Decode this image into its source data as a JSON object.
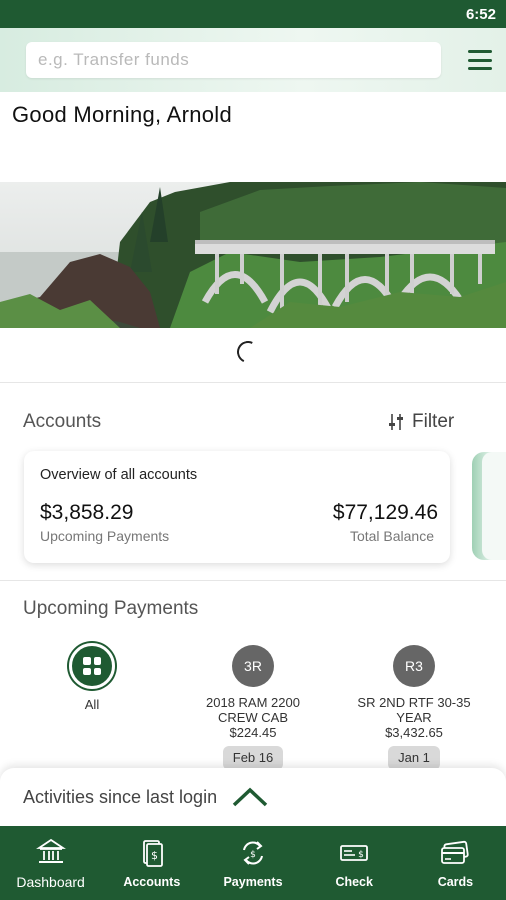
{
  "status": {
    "time": "6:52"
  },
  "search": {
    "placeholder": "e.g. Transfer funds"
  },
  "greeting": "Good Morning, Arnold",
  "accounts": {
    "title": "Accounts",
    "filter_label": "Filter",
    "card": {
      "overview": "Overview of all accounts",
      "upcoming_amount": "$3,858.29",
      "upcoming_label": "Upcoming Payments",
      "total_amount": "$77,129.46",
      "total_label": "Total Balance"
    }
  },
  "payments": {
    "title": "Upcoming Payments",
    "items": [
      {
        "label": "All"
      },
      {
        "badge": "3R",
        "line1": "2018 RAM 2200",
        "line2": "CREW CAB",
        "amount": "$224.45",
        "date": "Feb 16"
      },
      {
        "badge": "R3",
        "line1": "SR 2ND RTF 30-35",
        "line2": "YEAR",
        "amount": "$3,432.65",
        "date": "Jan 1"
      }
    ]
  },
  "activities": {
    "label": "Activities since last login"
  },
  "nav": {
    "items": [
      {
        "label": "Dashboard",
        "icon": "bank-icon"
      },
      {
        "label": "Accounts",
        "icon": "accounts-icon"
      },
      {
        "label": "Payments",
        "icon": "payments-icon"
      },
      {
        "label": "Check",
        "icon": "check-icon"
      },
      {
        "label": "Cards",
        "icon": "cards-icon"
      }
    ]
  },
  "colors": {
    "brand": "#1f5a32",
    "accent_light": "#d7ece0"
  }
}
